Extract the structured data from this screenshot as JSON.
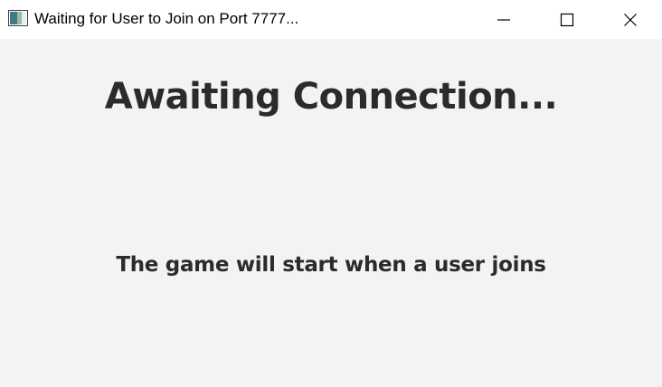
{
  "window": {
    "title": "Waiting for User to Join on Port 7777...",
    "icon": "app-window-icon",
    "controls": {
      "minimize_icon": "minimize-icon",
      "maximize_icon": "maximize-icon",
      "close_icon": "close-icon"
    }
  },
  "main": {
    "heading": "Awaiting Connection...",
    "message": "The game will start when a user joins"
  },
  "colors": {
    "titlebar_background": "#ffffff",
    "content_background": "#f3f3f3",
    "text": "#2b2b2b"
  }
}
